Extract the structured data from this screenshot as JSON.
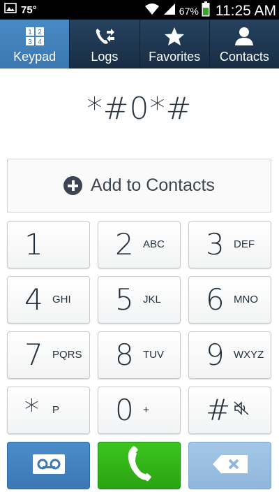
{
  "status_bar": {
    "temperature": "75°",
    "battery_percent": "67%",
    "time": "11:25 AM",
    "icons": [
      "gallery-icon",
      "wifi-icon",
      "signal-icon",
      "battery-icon"
    ]
  },
  "tabs": [
    {
      "label": "Keypad",
      "icon": "keypad-icon",
      "active": true
    },
    {
      "label": "Logs",
      "icon": "logs-icon",
      "active": false
    },
    {
      "label": "Favorites",
      "icon": "star-icon",
      "active": false
    },
    {
      "label": "Contacts",
      "icon": "person-icon",
      "active": false
    }
  ],
  "keypad_grid_icon": [
    "1",
    "2",
    "3",
    "4"
  ],
  "dialed_number": "*#0*#",
  "add_to_contacts": "Add to Contacts",
  "keys": [
    {
      "digit": "1",
      "letters": ""
    },
    {
      "digit": "2",
      "letters": "ABC"
    },
    {
      "digit": "3",
      "letters": "DEF"
    },
    {
      "digit": "4",
      "letters": "GHI"
    },
    {
      "digit": "5",
      "letters": "JKL"
    },
    {
      "digit": "6",
      "letters": "MNO"
    },
    {
      "digit": "7",
      "letters": "PQRS"
    },
    {
      "digit": "8",
      "letters": "TUV"
    },
    {
      "digit": "9",
      "letters": "WXYZ"
    },
    {
      "digit": "*",
      "letters": "P"
    },
    {
      "digit": "0",
      "letters": "+"
    },
    {
      "digit": "#",
      "letters": ""
    }
  ],
  "actions": {
    "voicemail_icon": "voicemail-icon",
    "call_icon": "phone-icon",
    "delete_icon": "backspace-icon"
  },
  "colors": {
    "active_tab": "#3b78b2",
    "tab_bar": "#1d3550",
    "call_button": "#2aa312",
    "voicemail_button": "#3b78b4",
    "delete_button": "#8fb6dc"
  }
}
